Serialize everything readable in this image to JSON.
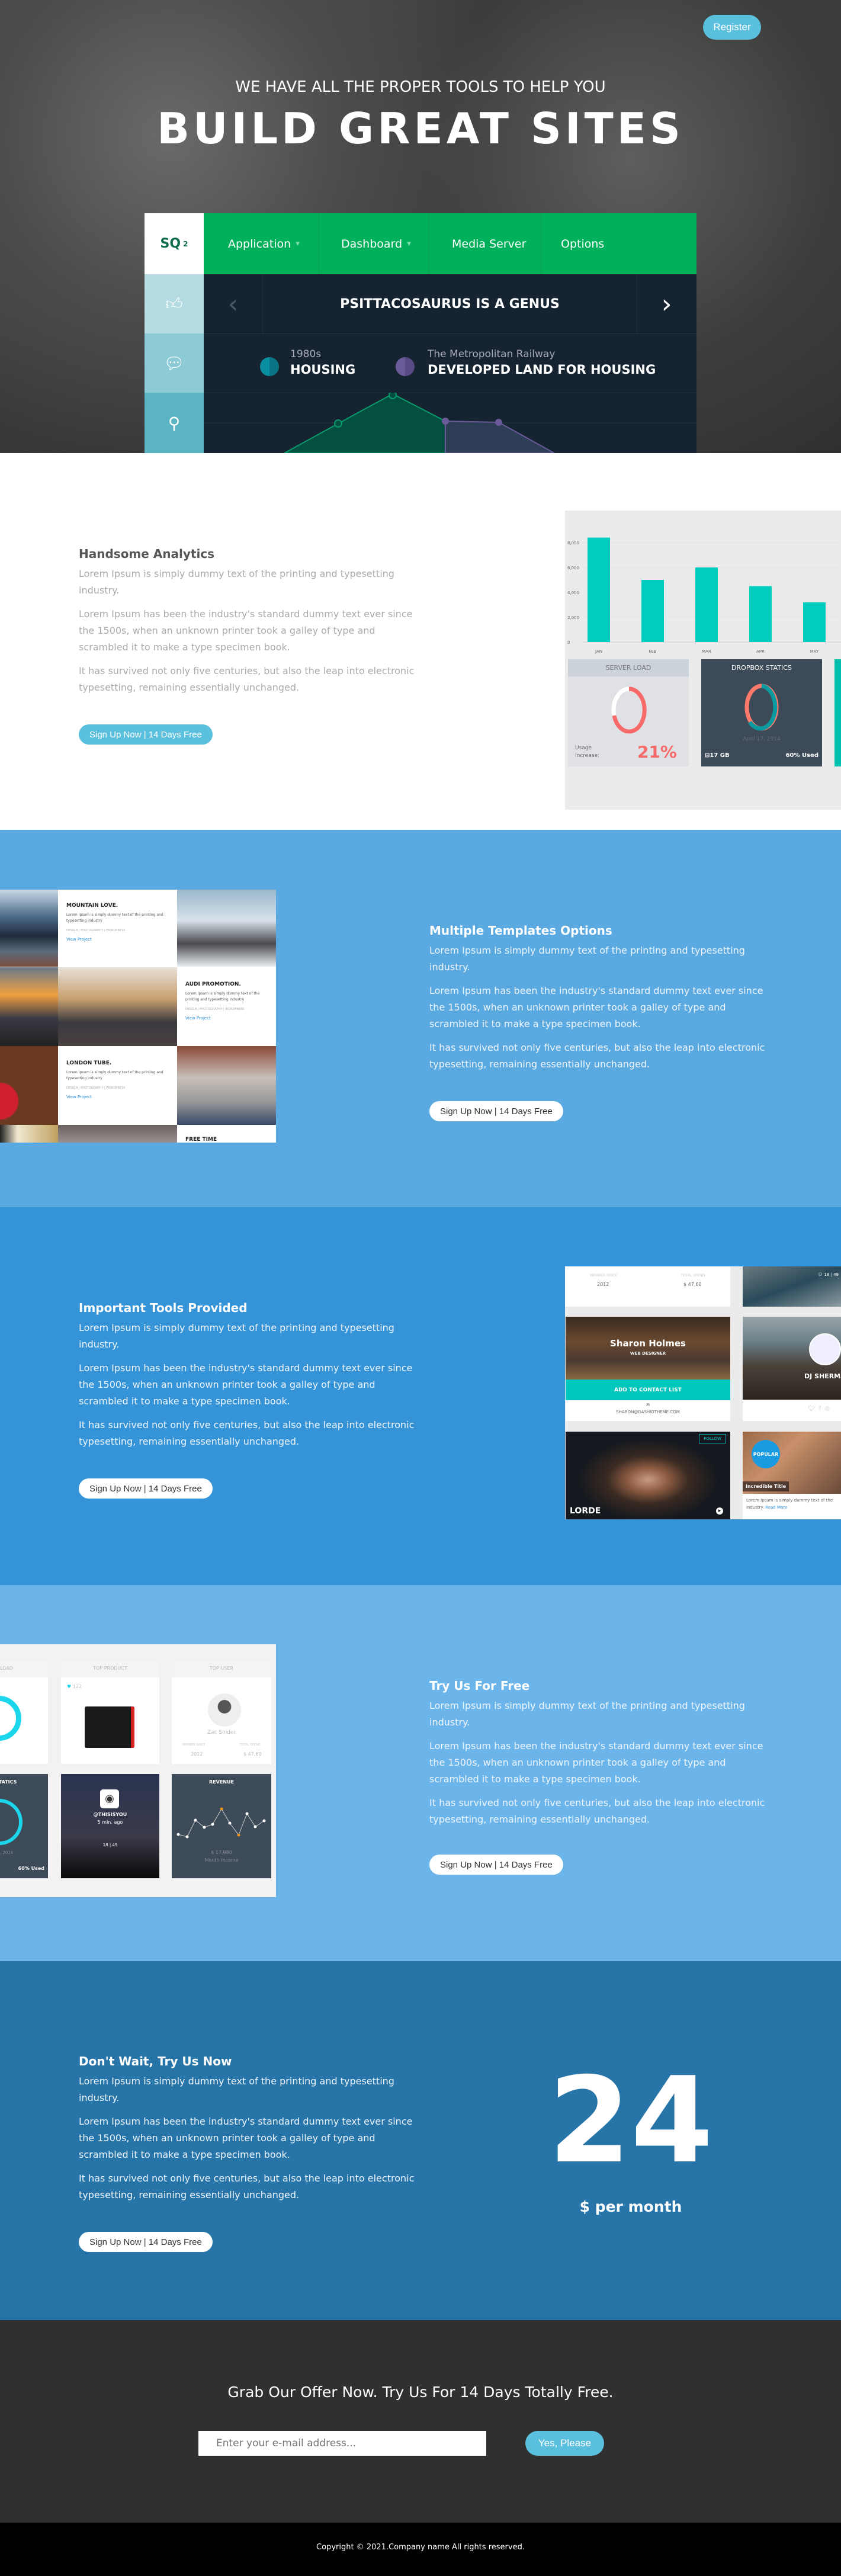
{
  "hero": {
    "register_label": "Register",
    "tagline": "WE HAVE ALL THE PROPER TOOLS TO HELP YOU",
    "title": "BUILD GREAT SITES",
    "dashboard": {
      "logo": "SQ",
      "logo_sup": "2",
      "nav": [
        "Application",
        "Dashboard",
        "Media Server",
        "Options"
      ],
      "slider_title": "PSITTACOSAURUS IS A GENUS",
      "legend": [
        {
          "small": "1980s",
          "big": "HOUSING",
          "color": "#0a8fa0"
        },
        {
          "small": "The Metropolitan Railway",
          "big": "DEVELOPED LAND FOR HOUSING",
          "color": "#6a5a9a"
        }
      ],
      "side_icons": [
        "thumbs-up-icon",
        "speech-bubble-icon",
        "search-icon"
      ]
    }
  },
  "sections": {
    "analytics": {
      "heading": "Handsome Analytics",
      "p1": "Lorem Ipsum is simply dummy text of the printing and typesetting industry.",
      "p2": "Lorem Ipsum has been the industry's standard dummy text ever since the 1500s, when an unknown printer took a galley of type and scrambled it to make a type specimen book.",
      "p3": "It has survived not only five centuries, but also the leap into electronic typesetting, remaining essentially unchanged.",
      "cta": "Sign Up Now | 14 Days Free",
      "mockup": {
        "bar_chart": {
          "type": "bar",
          "categories": [
            "JAN",
            "FEB",
            "MAR",
            "APR",
            "MAY"
          ],
          "values": [
            8400,
            5000,
            6000,
            4500,
            3200
          ],
          "yticks": [
            "0",
            "2,000",
            "4,000",
            "6,000",
            "8,000"
          ],
          "ylim": [
            0,
            8000
          ],
          "color": "#00cdc0"
        },
        "server_load": {
          "title": "SERVER LOAD",
          "label1": "Usage",
          "label2": "Increase:",
          "value": "21%",
          "percent": 21
        },
        "dropbox": {
          "title": "DROPBOX STATICS",
          "date": "April 17, 2014",
          "size": "17 GB",
          "used": "60% Used",
          "percent": 60
        }
      }
    },
    "templates": {
      "heading": "Multiple Templates Options",
      "p1": "Lorem Ipsum is simply dummy text of the printing and typesetting industry.",
      "p2": "Lorem Ipsum has been the industry's standard dummy text ever since the 1500s, when an unknown printer took a galley of type and scrambled it to make a type specimen book.",
      "p3": "It has survived not only five centuries, but also the leap into electronic typesetting, remaining essentially unchanged.",
      "cta": "Sign Up Now | 14 Days Free",
      "mockup": {
        "cards": [
          {
            "title": "MOUNTAIN LOVE.",
            "text": "Lorem Ipsum is simply dummy text of the printing and typesetting industry",
            "tags": "DESIGN | PHOTOGRAPHY | WORDPRESS",
            "link": "View Project"
          },
          {
            "title": "AUDI PROMOTION.",
            "text": "Lorem Ipsum is simply dummy text of the printing and typesetting industry",
            "tags": "DESIGN | PHOTOGRAPHY | WORDPRESS",
            "link": "View Project"
          },
          {
            "title": "LONDON TUBE.",
            "text": "Lorem Ipsum is simply dummy text of the printing and typesetting industry",
            "tags": "DESIGN | PHOTOGRAPHY | WORDPRESS",
            "link": "View Project"
          },
          {
            "title": "FREE TIME"
          }
        ]
      }
    },
    "tools": {
      "heading": "Important Tools Provided",
      "p1": "Lorem Ipsum is simply dummy text of the printing and typesetting industry.",
      "p2": "Lorem Ipsum has been the industry's standard dummy text ever since the 1500s, when an unknown printer took a galley of type and scrambled it to make a type specimen book.",
      "p3": "It has survived not only five centuries, but also the leap into electronic typesetting, remaining essentially unchanged.",
      "cta": "Sign Up Now | 14 Days Free",
      "mockup": {
        "member_since_label": "MEMBER SINCE",
        "member_since": "2012",
        "total_spend_label": "TOTAL SPEND",
        "total_spend": "$ 47,60",
        "photo_stats": "18 | 49",
        "profile_name": "Sharon Holmes",
        "profile_role": "WEB DESIGNER",
        "contact_button": "ADD TO CONTACT LIST",
        "email": "SHARON@DASHIOTHEME.COM",
        "dj_name": "DJ SHERMAN",
        "lorde": "LORDE",
        "follow": "FOLLOW",
        "popular": "POPULAR",
        "incredible_title": "Incredible Title",
        "popular_text": "Lorem Ipsum is simply dummy text of the industry.",
        "read_more": "Read More"
      }
    },
    "tryfree": {
      "heading": "Try Us For Free",
      "p1": "Lorem Ipsum is simply dummy text of the printing and typesetting industry.",
      "p2": "Lorem Ipsum has been the industry's standard dummy text ever since the 1500s, when an unknown printer took a galley of type and scrambled it to make a type specimen book.",
      "p3": "It has survived not only five centuries, but also the leap into electronic typesetting, remaining essentially unchanged.",
      "cta": "Sign Up Now | 14 Days Free",
      "mockup": {
        "server_load": "LOAD",
        "top_product": "TOP PRODUCT",
        "likes": "122",
        "top_user": "TOP USER",
        "user_name": "Zac Snider",
        "member_since_label": "MEMBER SINCE",
        "member_since": "2012",
        "total_spend_label": "TOTAL SPEND",
        "total_spend": "$ 47,60",
        "statics": "STATICS",
        "date": ", 2014",
        "used": "60% Used",
        "insta_handle": "@THISISYOU",
        "insta_time": "5 min. ago",
        "insta_stats": "18 | 49",
        "revenue": "REVENUE",
        "revenue_value": "$ 17,980",
        "revenue_label": "Month Income"
      }
    },
    "dontwait": {
      "heading": "Don't Wait, Try Us Now",
      "p1": "Lorem Ipsum is simply dummy text of the printing and typesetting industry.",
      "p2": "Lorem Ipsum has been the industry's standard dummy text ever since the 1500s, when an unknown printer took a galley of type and scrambled it to make a type specimen book.",
      "p3": "It has survived not only five centuries, but also the leap into electronic typesetting, remaining essentially unchanged.",
      "cta": "Sign Up Now | 14 Days Free",
      "price": "24",
      "price_unit": "$ per month"
    }
  },
  "offer": {
    "heading": "Grab Our Offer Now. Try Us For 14 Days Totally Free.",
    "email_placeholder": "Enter your e-mail address...",
    "button": "Yes, Please"
  },
  "footer": {
    "copyright": "Copyright © 2021.Company name All rights reserved."
  },
  "colors": {
    "accent": "#5bc0de",
    "green_nav": "#00b05a",
    "teal": "#00cdc0"
  }
}
